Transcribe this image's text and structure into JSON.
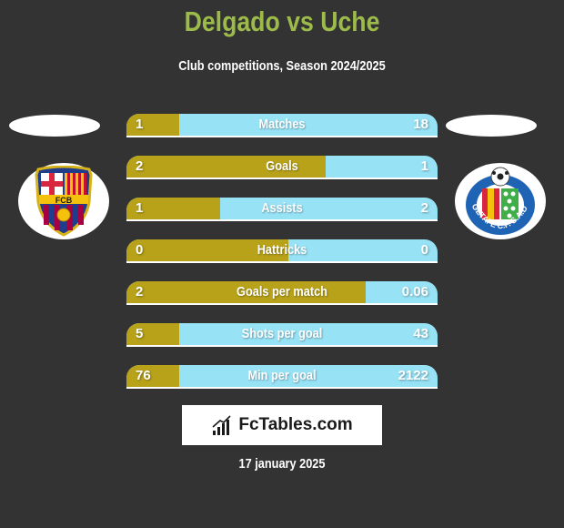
{
  "header": {
    "title": "Delgado vs Uche",
    "subtitle": "Club competitions, Season 2024/2025"
  },
  "teams": {
    "left": {
      "logo_icon": "fc-barcelona-crest-icon",
      "crest_text": "FCB"
    },
    "right": {
      "logo_icon": "getafe-cf-crest-icon",
      "crest_text": "GETAFE C.F. S.A.D."
    }
  },
  "colors": {
    "left_bar": "#b8a21a",
    "right_bar": "#98e2f6",
    "title": "#9dbb4a",
    "background": "#333333"
  },
  "stats": [
    {
      "label": "Matches",
      "left": "1",
      "right": "18",
      "left_share": 0.17
    },
    {
      "label": "Goals",
      "left": "2",
      "right": "1",
      "left_share": 0.64
    },
    {
      "label": "Assists",
      "left": "1",
      "right": "2",
      "left_share": 0.3
    },
    {
      "label": "Hattricks",
      "left": "0",
      "right": "0",
      "left_share": 0.52
    },
    {
      "label": "Goals per match",
      "left": "2",
      "right": "0.06",
      "left_share": 0.77
    },
    {
      "label": "Shots per goal",
      "left": "5",
      "right": "43",
      "left_share": 0.17
    },
    {
      "label": "Min per goal",
      "left": "76",
      "right": "2122",
      "left_share": 0.17
    }
  ],
  "brand": {
    "icon": "bar-chart-icon",
    "text": "FcTables.com"
  },
  "footer": {
    "date": "17 january 2025"
  }
}
